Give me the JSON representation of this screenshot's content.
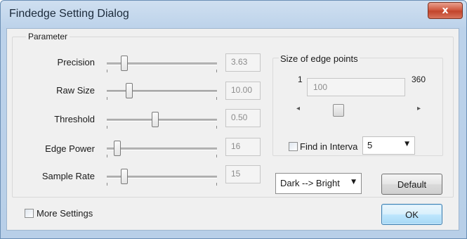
{
  "window": {
    "title": "Findedge Setting Dialog",
    "close_label": "x"
  },
  "parameter_group": {
    "label": "Parameter",
    "rows": [
      {
        "label": "Precision",
        "value": "3.63",
        "slider_fraction": 0.15
      },
      {
        "label": "Raw Size",
        "value": "10.00",
        "slider_fraction": 0.2
      },
      {
        "label": "Threshold",
        "value": "0.50",
        "slider_fraction": 0.5
      },
      {
        "label": "Edge Power",
        "value": "16",
        "slider_fraction": 0.08
      },
      {
        "label": "Sample Rate",
        "value": "15",
        "slider_fraction": 0.15
      }
    ]
  },
  "edge_points": {
    "label": "Size of edge points",
    "min": "1",
    "max": "360",
    "value": "100",
    "scroll_fraction": 0.3
  },
  "find_in_interval": {
    "label": "Find in Interva",
    "checked": false,
    "selected": "5"
  },
  "direction_select": {
    "selected": "Dark --> Bright"
  },
  "buttons": {
    "default_label": "Default",
    "ok_label": "OK"
  },
  "more_settings": {
    "label": "More Settings",
    "checked": false
  },
  "colors": {
    "title_bar": "#bcd2ea",
    "close_button": "#c2452c",
    "dialog_background": "#f0f0f0",
    "ok_button_border": "#3c7fb1"
  },
  "icons": {
    "close": "close-icon",
    "dropdown": "chevron-down-icon",
    "scroll_left": "arrow-left-icon",
    "scroll_right": "arrow-right-icon"
  }
}
